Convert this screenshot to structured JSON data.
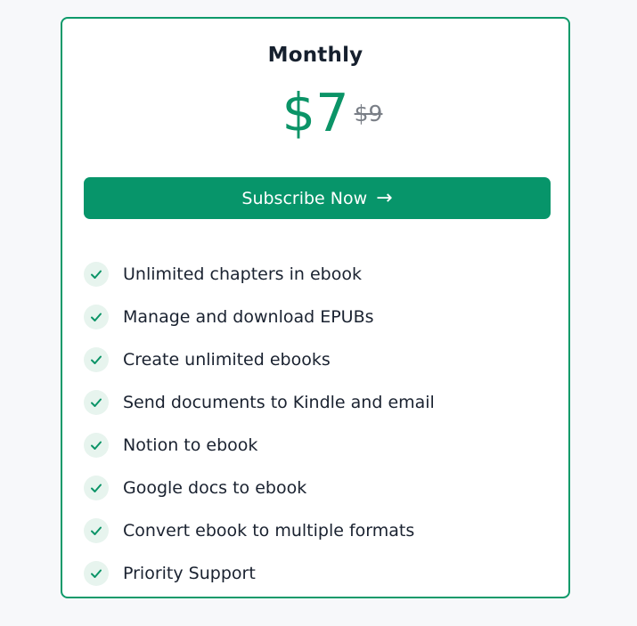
{
  "plan": {
    "title": "Monthly",
    "price_current": "$7",
    "price_old": "$9"
  },
  "button": {
    "label": "Subscribe Now",
    "icon": "arrow-right-icon",
    "arrow": "→"
  },
  "features": [
    "Unlimited chapters in ebook",
    "Manage and download EPUBs",
    "Create unlimited ebooks",
    "Send documents to Kindle and email",
    "Notion to ebook",
    "Google docs to ebook",
    "Convert ebook to multiple formats",
    "Priority Support"
  ],
  "colors": {
    "accent": "#07956a",
    "border": "#0e9a6a",
    "check_bg": "#e7f4ee"
  }
}
